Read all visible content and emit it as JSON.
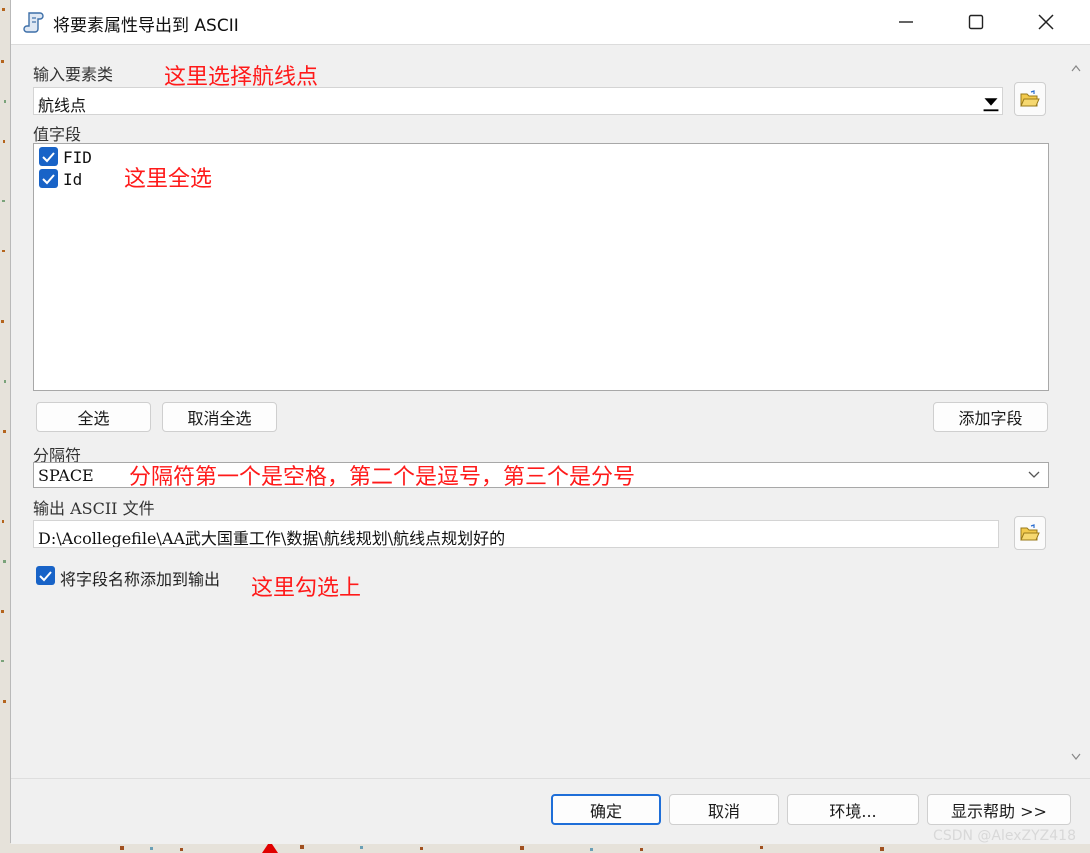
{
  "window": {
    "title": "将要素属性导出到 ASCII"
  },
  "input_feature": {
    "label": "输入要素类",
    "annotation": "这里选择航线点",
    "value": "航线点"
  },
  "value_fields": {
    "label": "值字段",
    "annotation": "这里全选",
    "items": [
      {
        "label": "FID",
        "checked": true
      },
      {
        "label": "Id",
        "checked": true
      }
    ]
  },
  "buttons": {
    "select_all": "全选",
    "deselect_all": "取消全选",
    "add_field": "添加字段"
  },
  "delimiter": {
    "label": "分隔符",
    "value": "SPACE",
    "annotation": "分隔符第一个是空格，第二个是逗号，第三个是分号"
  },
  "output": {
    "label": "输出 ASCII 文件",
    "value": "D:\\Acollegefile\\AA武大国重工作\\数据\\航线规划\\航线点规划好的"
  },
  "add_field_names": {
    "label": "将字段名称添加到输出",
    "checked": true,
    "annotation": "这里勾选上"
  },
  "footer": {
    "ok": "确定",
    "cancel": "取消",
    "environments": "环境...",
    "show_help": "显示帮助 >>"
  },
  "watermark": "CSDN @AlexZYZ418",
  "colors": {
    "annotation": "#ff1a1a",
    "checkbox": "#1863c7",
    "primary_border": "#1e6ed8"
  }
}
